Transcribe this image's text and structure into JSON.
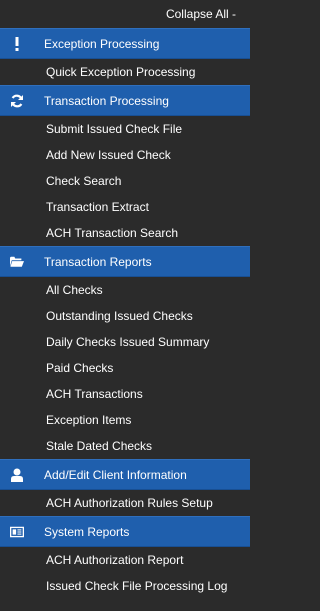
{
  "collapse_label": "Collapse All -",
  "sections": [
    {
      "name": "exception-processing",
      "label": "Exception Processing",
      "icon": "exclamation-icon",
      "items": [
        "Quick Exception Processing"
      ]
    },
    {
      "name": "transaction-processing",
      "label": "Transaction Processing",
      "icon": "refresh-icon",
      "items": [
        "Submit Issued Check File",
        "Add New Issued Check",
        "Check Search",
        "Transaction Extract",
        "ACH Transaction Search"
      ]
    },
    {
      "name": "transaction-reports",
      "label": "Transaction Reports",
      "icon": "folder-open-icon",
      "items": [
        "All Checks",
        "Outstanding Issued Checks",
        "Daily Checks Issued Summary",
        "Paid Checks",
        "ACH Transactions",
        "Exception Items",
        "Stale Dated Checks"
      ]
    },
    {
      "name": "client-information",
      "label": "Add/Edit Client Information",
      "icon": "user-icon",
      "items": [
        "ACH Authorization Rules Setup"
      ]
    },
    {
      "name": "system-reports",
      "label": "System Reports",
      "icon": "report-card-icon",
      "items": [
        "ACH Authorization Report",
        "Issued Check File Processing Log"
      ]
    }
  ],
  "colors": {
    "header_bg": "#1f5fad",
    "panel_bg": "#2b2b2b",
    "text": "#ffffff"
  }
}
